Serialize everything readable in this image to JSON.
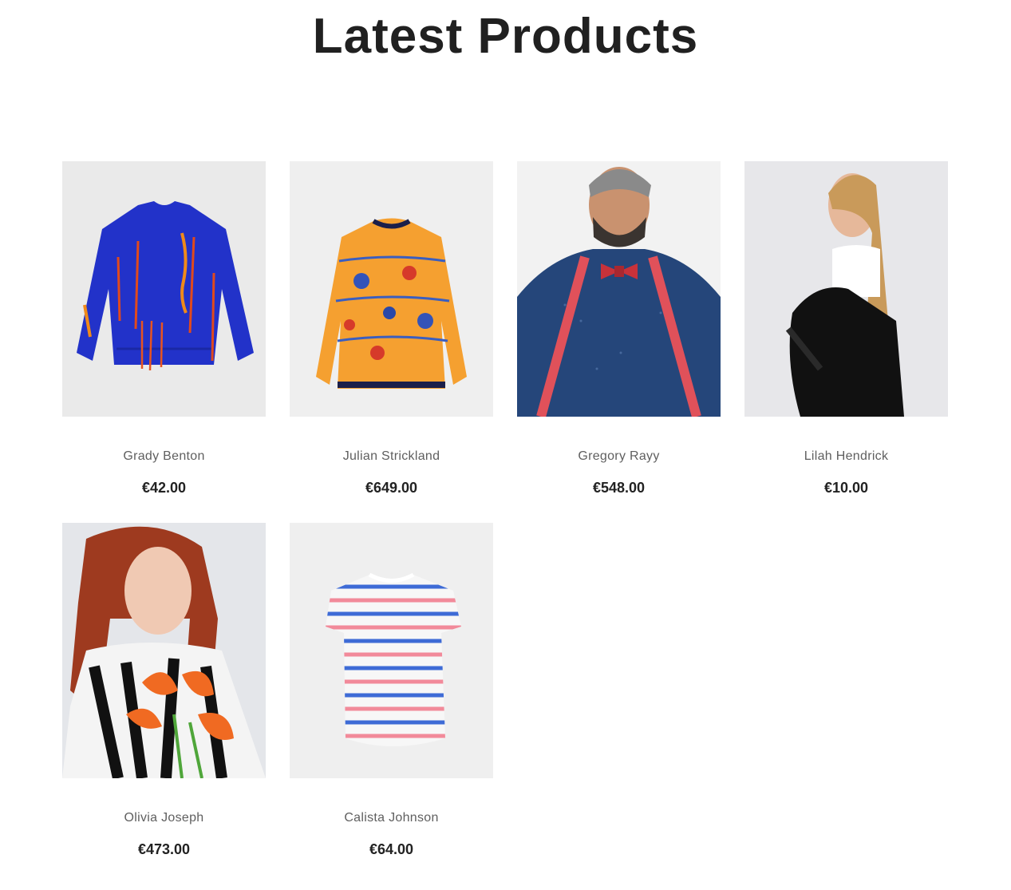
{
  "page": {
    "title": "Latest Products"
  },
  "products": [
    {
      "name": "Grady Benton",
      "price": "€42.00",
      "image": "blue-sweater-image"
    },
    {
      "name": "Julian Strickland",
      "price": "€649.00",
      "image": "orange-floral-sweater-image"
    },
    {
      "name": "Gregory Rayy",
      "price": "€548.00",
      "image": "man-bowtie-suspenders-image"
    },
    {
      "name": "Lilah Hendrick",
      "price": "€10.00",
      "image": "woman-black-jacket-image"
    },
    {
      "name": "Olivia Joseph",
      "price": "€473.00",
      "image": "woman-red-hair-flowers-image"
    },
    {
      "name": "Calista Johnson",
      "price": "€64.00",
      "image": "striped-tshirt-image"
    }
  ],
  "colors": {
    "title": "#202020",
    "name": "#5f5f5f",
    "price": "#222222",
    "thumb_bg": "#efefef"
  }
}
